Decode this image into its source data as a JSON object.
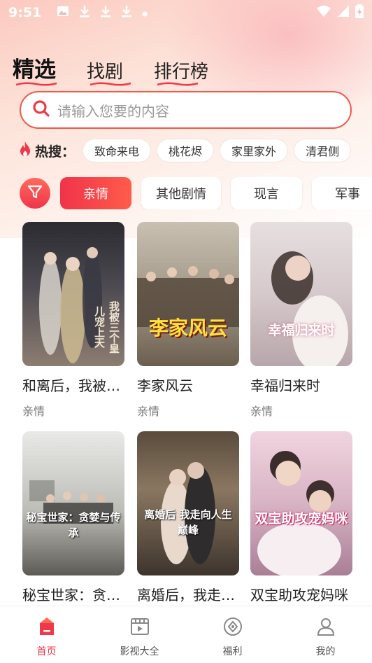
{
  "status": {
    "time": "9:51"
  },
  "tabs": [
    {
      "label": "精选",
      "active": true
    },
    {
      "label": "找剧",
      "active": false
    },
    {
      "label": "排行榜",
      "active": false
    }
  ],
  "search": {
    "placeholder": "请输入您要的内容"
  },
  "hot": {
    "label": "热搜：",
    "chips": [
      "致命来电",
      "桃花烬",
      "家里家外",
      "清君侧"
    ]
  },
  "categories": [
    {
      "label": "亲情",
      "active": true
    },
    {
      "label": "其他剧情",
      "active": false
    },
    {
      "label": "现言",
      "active": false
    },
    {
      "label": "军事",
      "active": false
    }
  ],
  "dramas": [
    {
      "title": "和离后，我被…",
      "genre": "亲情",
      "poster_text": "我被三个皇儿宠上天"
    },
    {
      "title": "李家风云",
      "genre": "亲情",
      "poster_text": "李家风云"
    },
    {
      "title": "幸福归来时",
      "genre": "亲情",
      "poster_text": "幸福归来时"
    },
    {
      "title": "秘宝世家：贪…",
      "genre": "",
      "poster_text": "秘宝世家：贪婪与传承"
    },
    {
      "title": "离婚后，我走…",
      "genre": "",
      "poster_text": "离婚后 我走向人生巅峰"
    },
    {
      "title": "双宝助攻宠妈咪",
      "genre": "",
      "poster_text": "双宝助攻宠妈咪"
    }
  ],
  "nav": [
    {
      "label": "首页",
      "active": true,
      "icon": "home-icon"
    },
    {
      "label": "影视大全",
      "active": false,
      "icon": "film-icon"
    },
    {
      "label": "福利",
      "active": false,
      "icon": "gift-icon"
    },
    {
      "label": "我的",
      "active": false,
      "icon": "user-icon"
    }
  ],
  "colors": {
    "accent": "#f0384b",
    "accent_light": "#ff6b5c"
  }
}
